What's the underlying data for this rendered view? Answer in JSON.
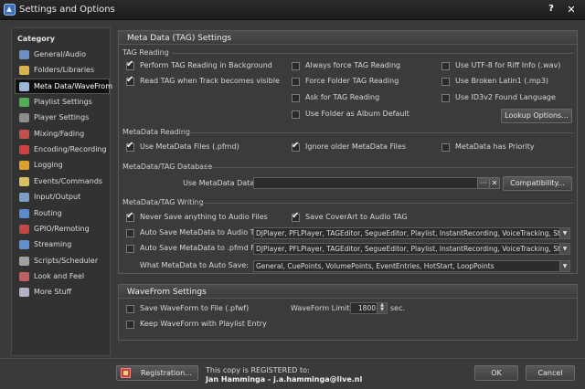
{
  "window": {
    "title": "Settings and Options",
    "help": "?",
    "close": "✕"
  },
  "sidebar": {
    "heading": "Category",
    "items": [
      {
        "label": "General/Audio",
        "icon": "speaker-icon",
        "color": "#6a8fc4"
      },
      {
        "label": "Folders/Libraries",
        "icon": "folder-icon",
        "color": "#d8b24a"
      },
      {
        "label": "Meta Data/WaveFrom",
        "icon": "metadata-icon",
        "color": "#9bb8d8",
        "selected": true
      },
      {
        "label": "Playlist Settings",
        "icon": "playlist-icon",
        "color": "#4fae4f"
      },
      {
        "label": "Player Settings",
        "icon": "player-icon",
        "color": "#8c8c8c"
      },
      {
        "label": "Mixing/Fading",
        "icon": "mixing-icon",
        "color": "#c0504d"
      },
      {
        "label": "Encoding/Recording",
        "icon": "record-icon",
        "color": "#d04040"
      },
      {
        "label": "Logging",
        "icon": "logging-icon",
        "color": "#e0a030"
      },
      {
        "label": "Events/Commands",
        "icon": "events-icon",
        "color": "#d8c060"
      },
      {
        "label": "Input/Output",
        "icon": "io-icon",
        "color": "#7aa0c8"
      },
      {
        "label": "Routing",
        "icon": "routing-icon",
        "color": "#5a8ad0"
      },
      {
        "label": "GPIO/Remoting",
        "icon": "gpio-icon",
        "color": "#c04848"
      },
      {
        "label": "Streaming",
        "icon": "streaming-icon",
        "color": "#6090d0"
      },
      {
        "label": "Scripts/Scheduler",
        "icon": "scripts-icon",
        "color": "#a0a0a0"
      },
      {
        "label": "Look and Feel",
        "icon": "look-icon",
        "color": "#c06060"
      },
      {
        "label": "More Stuff",
        "icon": "more-icon",
        "color": "#b0b0c8"
      }
    ]
  },
  "meta": {
    "title": "Meta Data (TAG) Settings",
    "tag_reading": {
      "heading": "TAG Reading",
      "perform": {
        "label": "Perform TAG Reading in Background",
        "checked": true
      },
      "read_visible": {
        "label": "Read TAG when Track becomes visible",
        "checked": true
      },
      "always_force": {
        "label": "Always force TAG Reading",
        "checked": false
      },
      "force_folder": {
        "label": "Force Folder TAG Reading",
        "checked": false
      },
      "ask": {
        "label": "Ask for TAG Reading",
        "checked": false
      },
      "use_folder": {
        "label": "Use Folder as Album Default",
        "checked": false
      },
      "utf8": {
        "label": "Use UTF-8 for Riff Info (.wav)",
        "checked": false
      },
      "broken": {
        "label": "Use Broken Latin1 (.mp3)",
        "checked": false
      },
      "id3": {
        "label": "Use ID3v2 Found Language",
        "checked": false
      },
      "lookup_btn": "Lookup Options..."
    },
    "metadata_reading": {
      "heading": "MetaData Reading",
      "use_files": {
        "label": "Use MetaData Files (.pfmd)",
        "checked": true
      },
      "ignore_older": {
        "label": "Ignore older MetaData Files",
        "checked": true
      },
      "priority": {
        "label": "MetaData has Priority",
        "checked": false
      }
    },
    "database": {
      "heading": "MetaData/TAG Database",
      "label": "Use MetaData Database:",
      "value": "",
      "dots": "···",
      "clear": "✕",
      "compat_btn": "Compatibility..."
    },
    "writing": {
      "heading": "MetaData/TAG Writing",
      "never_save": {
        "label": "Never Save anything to Audio Files",
        "checked": true
      },
      "save_coverart": {
        "label": "Save CoverArt to Audio TAG",
        "checked": true
      },
      "auto_tag": {
        "label": "Auto Save MetaData to Audio TAG:",
        "checked": false,
        "value": "DJPlayer, PFLPlayer, TAGEditor, SegueEditor, Playlist, InstantRecording, VoiceTracking, Stand..."
      },
      "auto_pfmd": {
        "label": "Auto Save MetaData to .pfmd File:",
        "checked": false,
        "value": "DJPlayer, PFLPlayer, TAGEditor, SegueEditor, Playlist, InstantRecording, VoiceTracking, Stand..."
      },
      "what_label": "What MetaData to Auto Save:",
      "what_value": "General, CuePoints, VolumePoints, EventEntries, HotStart, LoopPoints"
    }
  },
  "wave": {
    "title": "WaveFrom Settings",
    "save_pfwf": {
      "label": "Save WaveForm to File (.pfwf)",
      "checked": false
    },
    "keep": {
      "label": "Keep WaveForm with Playlist Entry",
      "checked": false
    },
    "limit_label": "WaveForm Limit:",
    "limit_value": "1800",
    "limit_unit": "sec."
  },
  "footer": {
    "registration_btn": "Registration...",
    "reg_text": "This copy is REGISTERED to:",
    "reg_owner": "Jan Hamminga - j.a.hamminga@live.nl",
    "ok": "OK",
    "cancel": "Cancel"
  }
}
